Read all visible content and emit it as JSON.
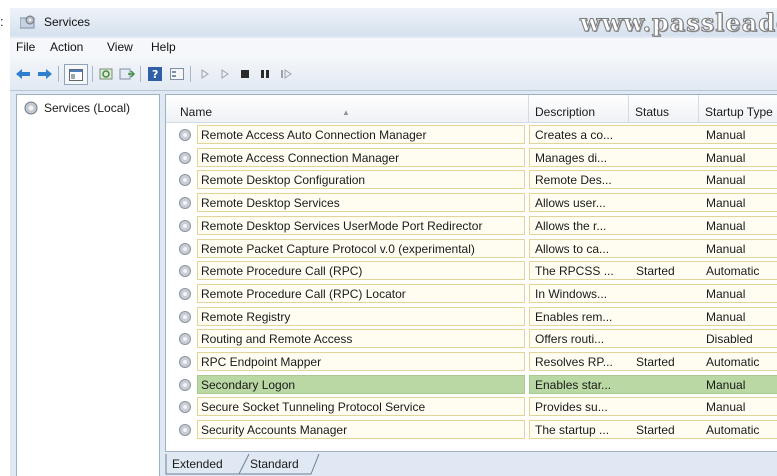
{
  "window": {
    "title": "Services",
    "leading_char": ":"
  },
  "watermark": "www.passleader.com",
  "menu": [
    "File",
    "Action",
    "View",
    "Help"
  ],
  "toolbar": {
    "buttons": [
      "back-arrow-icon",
      "forward-arrow-icon",
      "show-hide-tree-icon",
      "refresh-icon",
      "export-list-icon",
      "help-icon",
      "properties-icon",
      "start-service-icon",
      "start-service-alt-icon",
      "stop-service-icon",
      "pause-service-icon",
      "restart-service-icon"
    ]
  },
  "tree": {
    "root": "Services (Local)"
  },
  "columns": {
    "name": "Name",
    "description": "Description",
    "status": "Status",
    "startup": "Startup Type"
  },
  "services": [
    {
      "name": "Remote Access Auto Connection Manager",
      "description": "Creates a co...",
      "status": "",
      "startup": "Manual"
    },
    {
      "name": "Remote Access Connection Manager",
      "description": "Manages di...",
      "status": "",
      "startup": "Manual"
    },
    {
      "name": "Remote Desktop Configuration",
      "description": "Remote Des...",
      "status": "",
      "startup": "Manual"
    },
    {
      "name": "Remote Desktop Services",
      "description": "Allows user...",
      "status": "",
      "startup": "Manual"
    },
    {
      "name": "Remote Desktop Services UserMode Port Redirector",
      "description": "Allows the r...",
      "status": "",
      "startup": "Manual"
    },
    {
      "name": "Remote Packet Capture Protocol v.0 (experimental)",
      "description": "Allows to ca...",
      "status": "",
      "startup": "Manual"
    },
    {
      "name": "Remote Procedure Call (RPC)",
      "description": "The RPCSS ...",
      "status": "Started",
      "startup": "Automatic"
    },
    {
      "name": "Remote Procedure Call (RPC) Locator",
      "description": "In Windows...",
      "status": "",
      "startup": "Manual"
    },
    {
      "name": "Remote Registry",
      "description": "Enables rem...",
      "status": "",
      "startup": "Manual"
    },
    {
      "name": "Routing and Remote Access",
      "description": "Offers routi...",
      "status": "",
      "startup": "Disabled"
    },
    {
      "name": "RPC Endpoint Mapper",
      "description": "Resolves RP...",
      "status": "Started",
      "startup": "Automatic"
    },
    {
      "name": "Secondary Logon",
      "description": "Enables star...",
      "status": "",
      "startup": "Manual",
      "selected": true
    },
    {
      "name": "Secure Socket Tunneling Protocol Service",
      "description": "Provides su...",
      "status": "",
      "startup": "Manual"
    },
    {
      "name": "Security Accounts Manager",
      "description": "The startup ...",
      "status": "Started",
      "startup": "Automatic"
    }
  ],
  "tabs": [
    "Extended",
    "Standard"
  ],
  "colors": {
    "selected_row": "#b9d8a4",
    "row_box_border": "#e3d49a",
    "window_bg": "#dfe8f3"
  }
}
